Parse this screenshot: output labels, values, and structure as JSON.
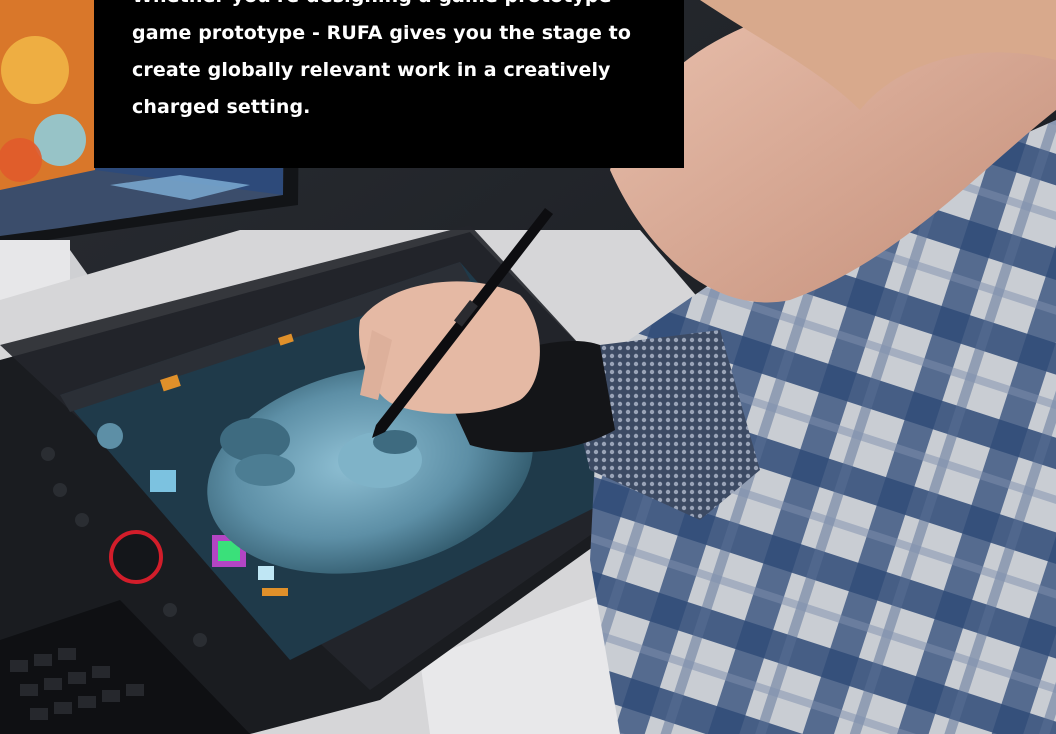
{
  "caption": {
    "lines": [
      "Whether you're designing a game prototype",
      "game prototype - RUFA gives you the stage to",
      "create globally relevant work in a creatively",
      "charged setting."
    ]
  },
  "photo": {
    "subject": "artist-sculpting-3d-head-on-pen-display",
    "colors": {
      "shirt_blue": "#2f4a78",
      "shirt_light": "#c9cdd3",
      "screen_model": "#5d8fa6",
      "screen_bg": "#1f3a4a",
      "monitor_orange": "#e0902a",
      "skin": "#e5b9a4",
      "hair": "#d8a98c",
      "dial_red": "#d21d2a"
    }
  }
}
